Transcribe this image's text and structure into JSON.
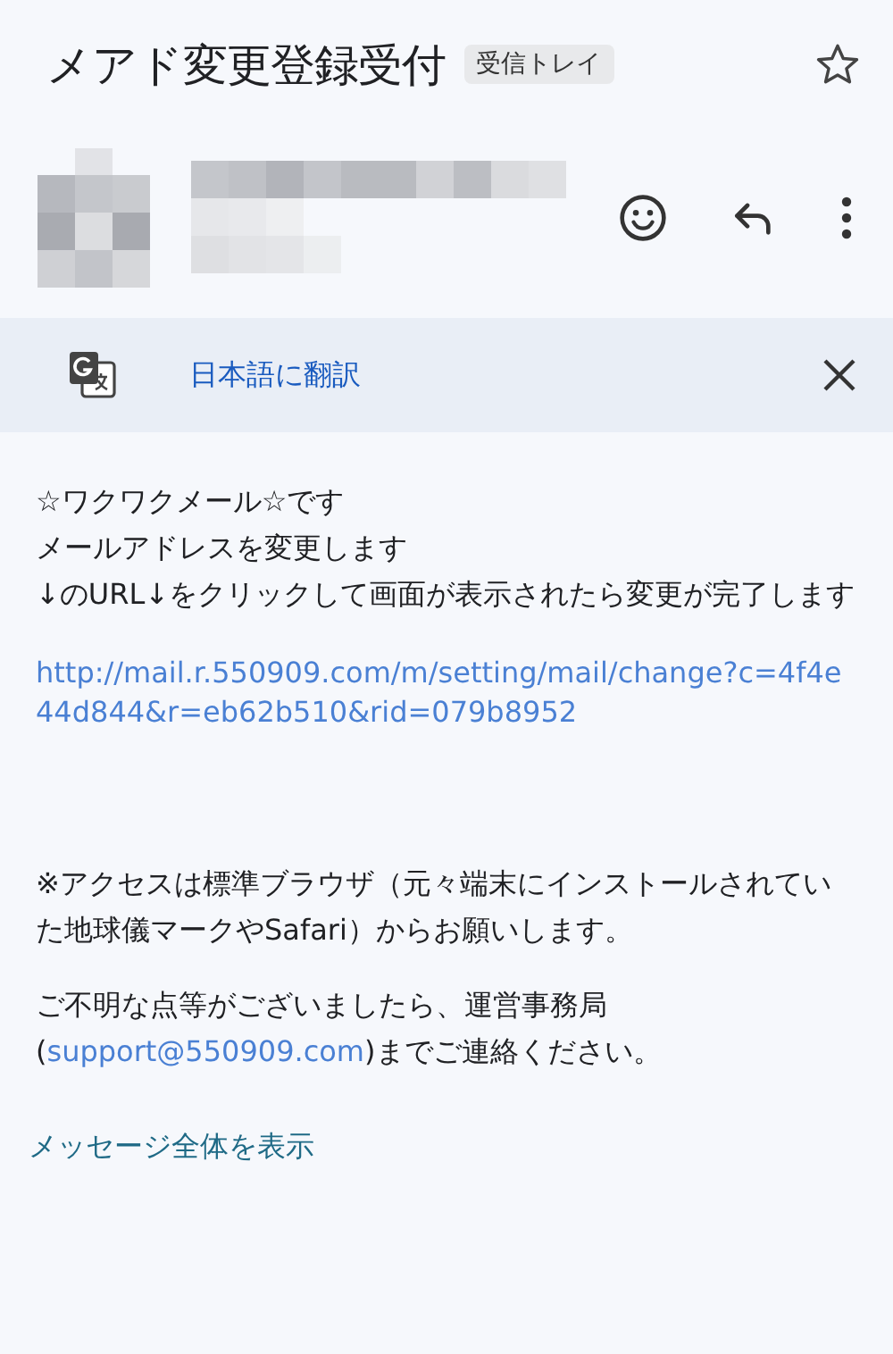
{
  "header": {
    "subject": "メアド変更登録受付",
    "label": "受信トレイ",
    "starred": false
  },
  "translate_bar": {
    "link": "日本語に翻訳"
  },
  "body": [
    {
      "kind": "text",
      "lines": [
        "☆ワクワクメール☆です",
        "メールアドレスを変更します",
        "↓のURL↓をクリックして画面が表示されたら変更が完了します"
      ]
    },
    {
      "kind": "link",
      "text": "http://mail.r.550909.com/m/setting/mail/change?c=4f4e44d844&r=eb62b510&rid=079b8952"
    },
    {
      "kind": "notice",
      "text": "※アクセスは標準ブラウザ（元々端末にインストールされていた地球儀マークやSafari）からお願いします。"
    },
    {
      "kind": "mixed",
      "before": "ご不明な点等がございましたら、運営事務局(",
      "link": "support@550909.com",
      "after": ")までご連絡ください。"
    }
  ],
  "show_full_message": "メッセージ全体を表示"
}
